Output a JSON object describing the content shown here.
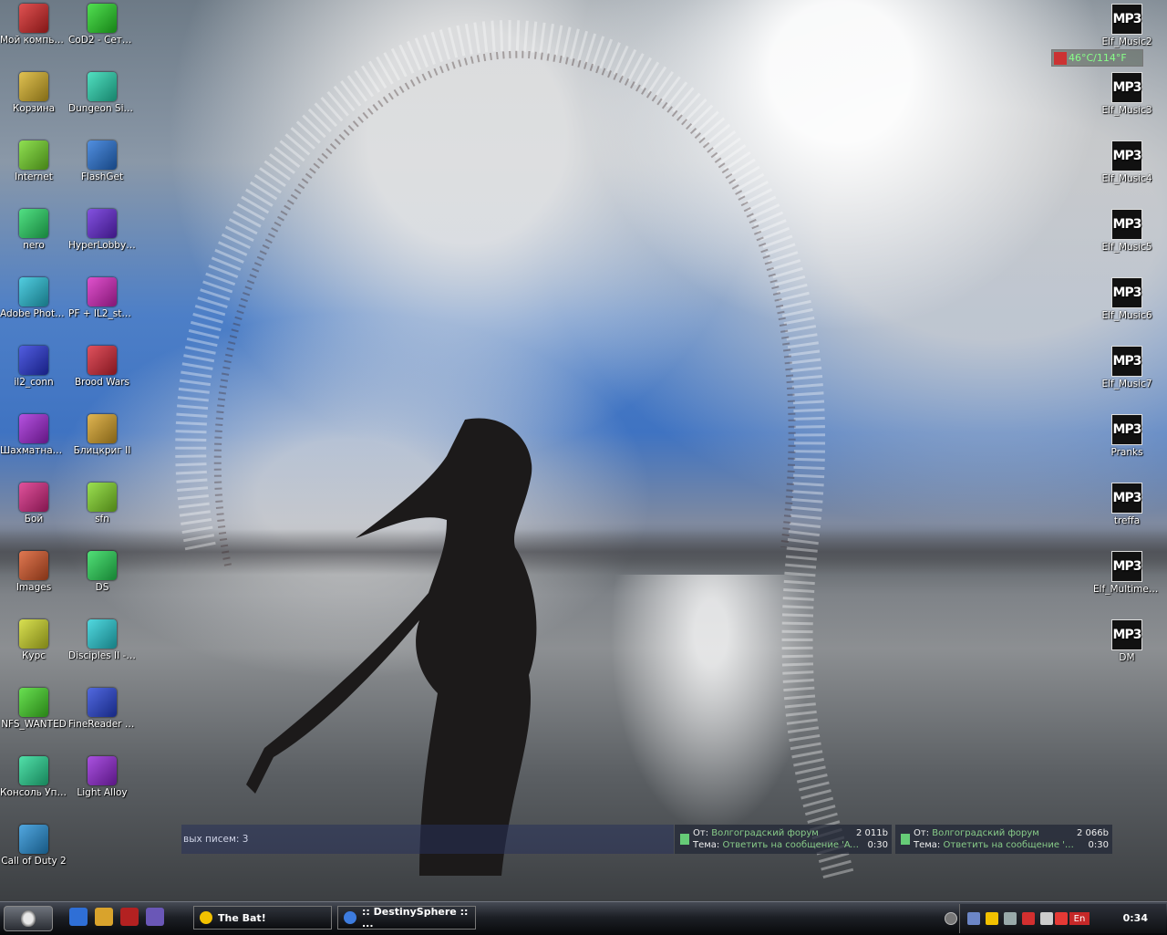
{
  "desktop": {
    "left_col1": [
      {
        "label": "Мой компьютер",
        "icon": "computer-icon"
      },
      {
        "label": "Корзина",
        "icon": "recycle-bin-icon"
      },
      {
        "label": "Internet",
        "icon": "internet-icon"
      },
      {
        "label": "nero",
        "icon": "nero-icon"
      },
      {
        "label": "Adobe Photoshop CS",
        "icon": "photoshop-icon"
      },
      {
        "label": "il2_conn",
        "icon": "il2-icon"
      },
      {
        "label": "Шахматная школа",
        "icon": "chess-icon"
      },
      {
        "label": "Бой",
        "icon": "fight-icon"
      },
      {
        "label": "Images",
        "icon": "images-icon"
      },
      {
        "label": "Курс",
        "icon": "russian-flag-icon"
      },
      {
        "label": "NFS_WANTED",
        "icon": "nfs-icon"
      },
      {
        "label": "Консоль Управления",
        "icon": "console-icon"
      },
      {
        "label": "Call of Duty 2",
        "icon": "cod2-icon"
      }
    ],
    "left_col2": [
      {
        "label": "CoD2 - Сетевая игра",
        "icon": "cod2-icon"
      },
      {
        "label": "Dungeon Siege2",
        "icon": "dungeon-siege-icon"
      },
      {
        "label": "FlashGet",
        "icon": "flashget-icon"
      },
      {
        "label": "HyperLobby Pro 3.x Client",
        "icon": "hyperlobby-icon"
      },
      {
        "label": "PF + IL2_sturmovik",
        "icon": "plane-icon"
      },
      {
        "label": "Brood Wars",
        "icon": "brood-wars-icon"
      },
      {
        "label": "Блицкриг II",
        "icon": "blitzkrieg-icon"
      },
      {
        "label": "sfn",
        "icon": "sfn-icon"
      },
      {
        "label": "DS",
        "icon": "ds-icon"
      },
      {
        "label": "Disciples II - Возвращен...",
        "icon": "disciples-icon"
      },
      {
        "label": "FineReader 8.0",
        "icon": "finereader-icon"
      },
      {
        "label": "Light Alloy",
        "icon": "light-alloy-icon"
      }
    ],
    "right_col": [
      {
        "label": "Elf_Music2",
        "icon": "mp3-icon"
      },
      {
        "label": "Elf_Music3",
        "icon": "mp3-icon"
      },
      {
        "label": "Elf_Music4",
        "icon": "mp3-icon"
      },
      {
        "label": "Elf_Music5",
        "icon": "mp3-icon"
      },
      {
        "label": "Elf_Music6",
        "icon": "mp3-icon"
      },
      {
        "label": "Elf_Music7",
        "icon": "mp3-icon"
      },
      {
        "label": "Pranks",
        "icon": "mp3-icon"
      },
      {
        "label": "treffa",
        "icon": "mp3-icon"
      },
      {
        "label": "Elf_Multimed1",
        "icon": "mp3-icon"
      },
      {
        "label": "DM",
        "icon": "mp3-icon"
      }
    ]
  },
  "mp3_glyph": "MP3",
  "temperature": {
    "value": "46°C/114°F"
  },
  "notifications": {
    "new_mail_text": "вых писем: 3",
    "mail1": {
      "from_label": "От:",
      "from": "Волгоградский форум",
      "subject_label": "Тема:",
      "subject": "Ответить на сообщение 'AT...",
      "size": "2 011b",
      "time": "0:30"
    },
    "mail2": {
      "from_label": "От:",
      "from": "Волгоградский форум",
      "subject_label": "Тема:",
      "subject": "Ответить на сообщение 'Wi...",
      "size": "2 066b",
      "time": "0:30"
    }
  },
  "taskbar": {
    "tasks": [
      {
        "label": "The Bat!",
        "icon": "bat-icon"
      },
      {
        "label": ":: DestinySphere :: ...",
        "icon": "browser-icon"
      }
    ],
    "tray_lang": "En",
    "clock": "0:34"
  }
}
